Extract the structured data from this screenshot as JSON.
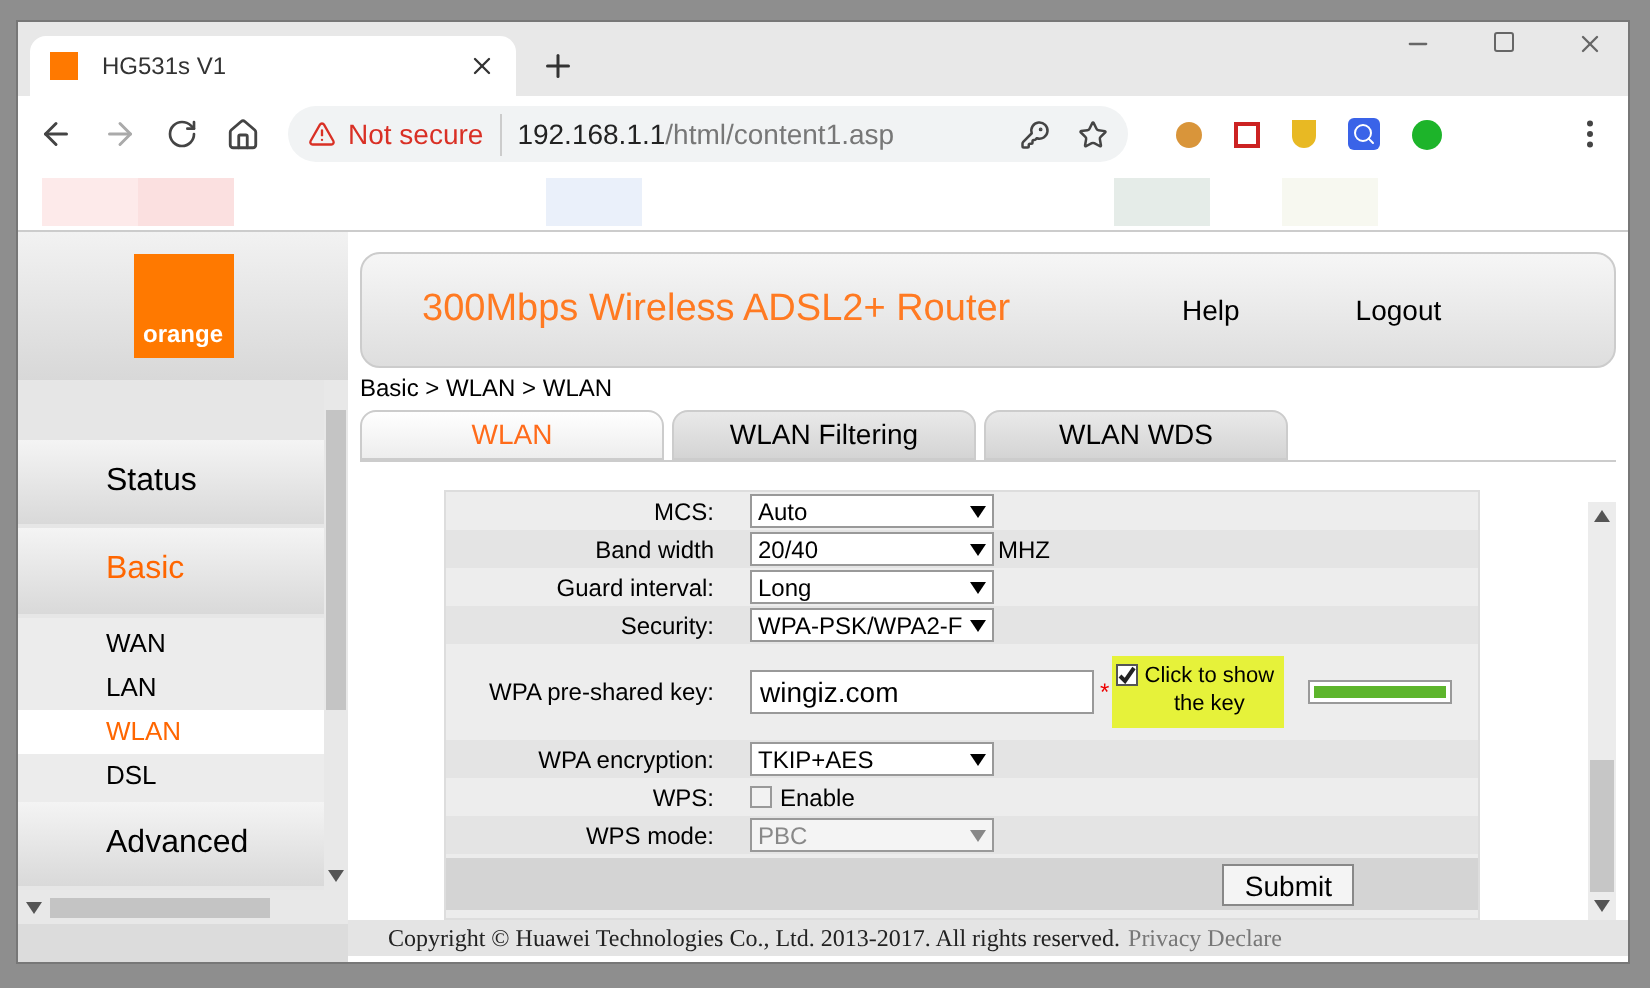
{
  "browser": {
    "tab_title": "HG531s V1",
    "security": "Not secure",
    "url_host": "192.168.1.1",
    "url_path": "/html/content1.asp"
  },
  "sidebar": {
    "logo": "orange",
    "items": [
      {
        "label": "Status",
        "selected": false
      },
      {
        "label": "Basic",
        "selected": true,
        "children": [
          {
            "label": "WAN",
            "selected": false
          },
          {
            "label": "LAN",
            "selected": false
          },
          {
            "label": "WLAN",
            "selected": true
          },
          {
            "label": "DSL",
            "selected": false
          }
        ]
      },
      {
        "label": "Advanced",
        "selected": false
      }
    ]
  },
  "header": {
    "title": "300Mbps Wireless ADSL2+ Router",
    "links": [
      "Help",
      "Logout"
    ]
  },
  "breadcrumb": "Basic > WLAN > WLAN",
  "tabs": [
    {
      "label": "WLAN",
      "selected": true
    },
    {
      "label": "WLAN Filtering",
      "selected": false
    },
    {
      "label": "WLAN WDS",
      "selected": false
    }
  ],
  "form": [
    {
      "kind": "select",
      "label": "MCS:",
      "value": "Auto",
      "disabled": false
    },
    {
      "kind": "select",
      "label": "Band width",
      "value": "20/40",
      "unit": "MHZ",
      "disabled": false
    },
    {
      "kind": "select",
      "label": "Guard interval:",
      "value": "Long",
      "disabled": false
    },
    {
      "kind": "select",
      "label": "Security:",
      "value": "WPA-PSK/WPA2-F",
      "disabled": false
    },
    {
      "kind": "key",
      "label": "WPA pre-shared key:",
      "value": "wingiz.com",
      "required_mark": "*",
      "show_key": {
        "label": "Click to show the key",
        "checked": true
      },
      "strength": {
        "level": 1
      }
    },
    {
      "kind": "select",
      "label": "WPA encryption:",
      "value": "TKIP+AES",
      "disabled": false
    },
    {
      "kind": "checkbox",
      "label": "WPS:",
      "option": "Enable",
      "checked": false
    },
    {
      "kind": "select",
      "label": "WPS mode:",
      "value": "PBC",
      "disabled": true
    }
  ],
  "submit": "Submit",
  "footer": {
    "copyright": "Copyright © Huawei Technologies Co., Ltd. 2013-2017. All rights reserved.",
    "link": "Privacy Declare"
  }
}
